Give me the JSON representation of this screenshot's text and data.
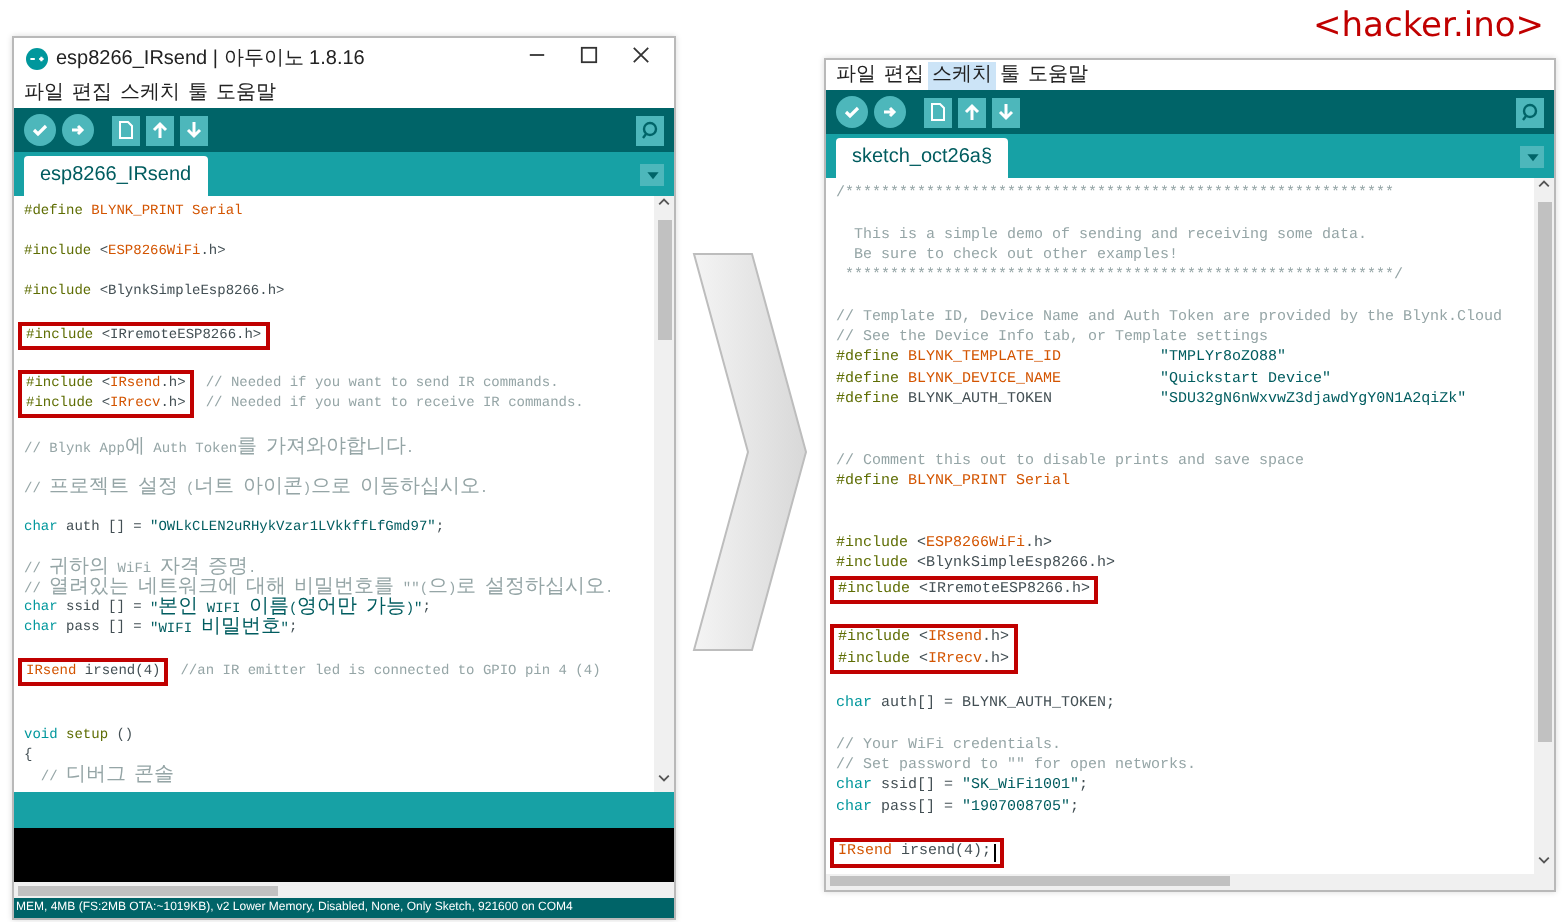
{
  "caption": "<hacker.ino>",
  "windows": [
    {
      "title": "esp8266_IRsend | 아두이노 1.8.16",
      "menu": [
        {
          "label": "파일",
          "selected": false
        },
        {
          "label": "편집",
          "selected": false
        },
        {
          "label": "스케치",
          "selected": false
        },
        {
          "label": "툴",
          "selected": false
        },
        {
          "label": "도움말",
          "selected": false
        }
      ],
      "tab": "esp8266_IRsend",
      "code": [
        {
          "highlighted": false,
          "lines": [
            {
              "kind": "code",
              "tokens": [
                {
                  "kind": "directive",
                  "text": "#define "
                },
                {
                  "kind": "macro",
                  "text": "BLYNK_PRINT Serial"
                }
              ]
            },
            {
              "kind": "blank"
            },
            {
              "kind": "code",
              "tokens": [
                {
                  "kind": "directive",
                  "text": "#include "
                },
                {
                  "kind": "plain",
                  "text": "<"
                },
                {
                  "kind": "macro",
                  "text": "ESP8266WiFi"
                },
                {
                  "kind": "plain",
                  "text": ".h>"
                }
              ]
            },
            {
              "kind": "blank"
            },
            {
              "kind": "code",
              "tokens": [
                {
                  "kind": "directive",
                  "text": "#include "
                },
                {
                  "kind": "plain",
                  "text": "<BlynkSimpleEsp8266.h>"
                }
              ]
            },
            {
              "kind": "blank"
            }
          ]
        },
        {
          "highlighted": true,
          "lines": [
            {
              "kind": "code",
              "tokens": [
                {
                  "kind": "directive",
                  "text": "#include "
                },
                {
                  "kind": "plain",
                  "text": "<IRremoteESP8266.h>"
                }
              ]
            }
          ]
        },
        {
          "highlighted": false,
          "lines": [
            {
              "kind": "blank"
            }
          ]
        },
        {
          "highlighted": true,
          "lines": [
            {
              "kind": "code",
              "tokens": [
                {
                  "kind": "directive",
                  "text": "#include "
                },
                {
                  "kind": "plain",
                  "text": "<"
                },
                {
                  "kind": "macro",
                  "text": "IRsend"
                },
                {
                  "kind": "plain",
                  "text": ".h>"
                }
              ],
              "trailing": [
                {
                  "kind": "comment",
                  "text": "// Needed if you want to send IR commands."
                }
              ]
            },
            {
              "kind": "code",
              "tokens": [
                {
                  "kind": "directive",
                  "text": "#include "
                },
                {
                  "kind": "plain",
                  "text": "<"
                },
                {
                  "kind": "macro",
                  "text": "IRrecv"
                },
                {
                  "kind": "plain",
                  "text": ".h>"
                }
              ],
              "trailing": [
                {
                  "kind": "comment",
                  "text": "// Needed if you want to receive IR commands."
                }
              ]
            }
          ]
        },
        {
          "highlighted": false,
          "lines": [
            {
              "kind": "blank"
            },
            {
              "kind": "code",
              "tokens": [
                {
                  "kind": "comment",
                  "text": "// Blynk App에 Auth Token를 가져와야합니다."
                }
              ]
            },
            {
              "kind": "blank"
            },
            {
              "kind": "code",
              "tokens": [
                {
                  "kind": "comment",
                  "text": "// 프로젝트 설정 (너트 아이콘)으로 이동하십시오."
                }
              ]
            },
            {
              "kind": "blank"
            },
            {
              "kind": "code",
              "tokens": [
                {
                  "kind": "type",
                  "text": "char"
                },
                {
                  "kind": "plain",
                  "text": " auth [] = "
                },
                {
                  "kind": "string",
                  "text": "\"OWLkCLEN2uRHykVzar1LVkkffLfGmd97\""
                },
                {
                  "kind": "plain",
                  "text": ";"
                }
              ]
            },
            {
              "kind": "blank"
            },
            {
              "kind": "code",
              "tokens": [
                {
                  "kind": "comment",
                  "text": "// 귀하의 WiFi 자격 증명."
                }
              ]
            },
            {
              "kind": "code",
              "tokens": [
                {
                  "kind": "comment",
                  "text": "// 열려있는 네트워크에 대해 비밀번호를 \"\"(으)로 설정하십시오."
                }
              ]
            },
            {
              "kind": "code",
              "tokens": [
                {
                  "kind": "type",
                  "text": "char"
                },
                {
                  "kind": "plain",
                  "text": " ssid [] = "
                },
                {
                  "kind": "string",
                  "text": "\"본인 WIFI 이름(영어만 가능)\""
                },
                {
                  "kind": "plain",
                  "text": ";"
                }
              ]
            },
            {
              "kind": "code",
              "tokens": [
                {
                  "kind": "type",
                  "text": "char"
                },
                {
                  "kind": "plain",
                  "text": " pass [] = "
                },
                {
                  "kind": "string",
                  "text": "\"WIFI 비밀번호\""
                },
                {
                  "kind": "plain",
                  "text": ";"
                }
              ]
            },
            {
              "kind": "blank"
            }
          ]
        },
        {
          "highlighted": true,
          "lines": [
            {
              "kind": "code",
              "tokens": [
                {
                  "kind": "macro",
                  "text": "IRsend"
                },
                {
                  "kind": "plain",
                  "text": " irsend(4)"
                }
              ],
              "trailing": [
                {
                  "kind": "comment",
                  "text": "//an IR emitter led is connected to GPIO pin 4 (4)"
                }
              ]
            }
          ]
        },
        {
          "highlighted": false,
          "lines": [
            {
              "kind": "blank"
            },
            {
              "kind": "blank"
            },
            {
              "kind": "code",
              "tokens": [
                {
                  "kind": "type",
                  "text": "void "
                },
                {
                  "kind": "directive",
                  "text": "setup"
                },
                {
                  "kind": "plain",
                  "text": " ()"
                }
              ]
            },
            {
              "kind": "code",
              "tokens": [
                {
                  "kind": "plain",
                  "text": "{"
                }
              ]
            },
            {
              "kind": "code",
              "tokens": [
                {
                  "kind": "comment",
                  "text": "  // 디버그 콘솔"
                }
              ]
            }
          ]
        }
      ],
      "status": "MEM, 4MB (FS:2MB OTA:~1019KB), v2 Lower Memory, Disabled, None, Only Sketch, 921600 on COM4"
    },
    {
      "menu": [
        {
          "label": "파일",
          "selected": false
        },
        {
          "label": "편집",
          "selected": false
        },
        {
          "label": "스케치",
          "selected": true
        },
        {
          "label": "툴",
          "selected": false
        },
        {
          "label": "도움말",
          "selected": false
        }
      ],
      "tab": "sketch_oct26a§",
      "code": [
        {
          "highlighted": false,
          "lines": [
            {
              "kind": "code",
              "tokens": [
                {
                  "kind": "comment",
                  "text": "/*************************************************************"
                }
              ]
            },
            {
              "kind": "blank"
            },
            {
              "kind": "code",
              "tokens": [
                {
                  "kind": "comment",
                  "text": "  This is a simple demo of sending and receiving some data."
                }
              ]
            },
            {
              "kind": "code",
              "tokens": [
                {
                  "kind": "comment",
                  "text": "  Be sure to check out other examples!"
                }
              ]
            },
            {
              "kind": "code",
              "tokens": [
                {
                  "kind": "comment",
                  "text": " *************************************************************/"
                }
              ]
            },
            {
              "kind": "blank"
            },
            {
              "kind": "code",
              "tokens": [
                {
                  "kind": "comment",
                  "text": "// Template ID, Device Name and Auth Token are provided by the Blynk.Cloud"
                }
              ]
            },
            {
              "kind": "code",
              "tokens": [
                {
                  "kind": "comment",
                  "text": "// See the Device Info tab, or Template settings"
                }
              ]
            },
            {
              "kind": "code",
              "tokens": [
                {
                  "kind": "directive",
                  "text": "#define "
                },
                {
                  "kind": "macro",
                  "text": "BLYNK_TEMPLATE_ID           "
                },
                {
                  "kind": "string",
                  "text": "\"TMPLYr8oZO88\""
                }
              ]
            },
            {
              "kind": "code",
              "tokens": [
                {
                  "kind": "directive",
                  "text": "#define "
                },
                {
                  "kind": "macro",
                  "text": "BLYNK_DEVICE_NAME           "
                },
                {
                  "kind": "string",
                  "text": "\"Quickstart Device\""
                }
              ]
            },
            {
              "kind": "code",
              "tokens": [
                {
                  "kind": "directive",
                  "text": "#define "
                },
                {
                  "kind": "plain",
                  "text": "BLYNK_AUTH_TOKEN            "
                },
                {
                  "kind": "string",
                  "text": "\"SDU32gN6nWxvwZ3djawdYgY0N1A2qiZk\""
                }
              ]
            },
            {
              "kind": "blank"
            },
            {
              "kind": "blank"
            },
            {
              "kind": "code",
              "tokens": [
                {
                  "kind": "comment",
                  "text": "// Comment this out to disable prints and save space"
                }
              ]
            },
            {
              "kind": "code",
              "tokens": [
                {
                  "kind": "directive",
                  "text": "#define "
                },
                {
                  "kind": "macro",
                  "text": "BLYNK_PRINT Serial"
                }
              ]
            },
            {
              "kind": "blank"
            },
            {
              "kind": "blank"
            },
            {
              "kind": "code",
              "tokens": [
                {
                  "kind": "directive",
                  "text": "#include "
                },
                {
                  "kind": "plain",
                  "text": "<"
                },
                {
                  "kind": "macro",
                  "text": "ESP8266WiFi"
                },
                {
                  "kind": "plain",
                  "text": ".h>"
                }
              ]
            },
            {
              "kind": "code",
              "tokens": [
                {
                  "kind": "directive",
                  "text": "#include "
                },
                {
                  "kind": "plain",
                  "text": "<BlynkSimpleEsp8266.h>"
                }
              ]
            }
          ]
        },
        {
          "highlighted": true,
          "lines": [
            {
              "kind": "code",
              "tokens": [
                {
                  "kind": "directive",
                  "text": "#include "
                },
                {
                  "kind": "plain",
                  "text": "<IRremoteESP8266.h>"
                }
              ]
            }
          ]
        },
        {
          "highlighted": false,
          "lines": [
            {
              "kind": "blank"
            }
          ]
        },
        {
          "highlighted": true,
          "lines": [
            {
              "kind": "code",
              "tokens": [
                {
                  "kind": "directive",
                  "text": "#include "
                },
                {
                  "kind": "plain",
                  "text": "<"
                },
                {
                  "kind": "macro",
                  "text": "IRsend"
                },
                {
                  "kind": "plain",
                  "text": ".h>"
                }
              ]
            },
            {
              "kind": "code",
              "tokens": [
                {
                  "kind": "directive",
                  "text": "#include "
                },
                {
                  "kind": "plain",
                  "text": "<"
                },
                {
                  "kind": "macro",
                  "text": "IRrecv"
                },
                {
                  "kind": "plain",
                  "text": ".h>"
                }
              ]
            }
          ]
        },
        {
          "highlighted": false,
          "lines": [
            {
              "kind": "blank"
            },
            {
              "kind": "code",
              "tokens": [
                {
                  "kind": "type",
                  "text": "char"
                },
                {
                  "kind": "plain",
                  "text": " auth[] = BLYNK_AUTH_TOKEN;"
                }
              ]
            },
            {
              "kind": "blank"
            },
            {
              "kind": "code",
              "tokens": [
                {
                  "kind": "comment",
                  "text": "// Your WiFi credentials."
                }
              ]
            },
            {
              "kind": "code",
              "tokens": [
                {
                  "kind": "comment",
                  "text": "// Set password to \"\" for open networks."
                }
              ]
            },
            {
              "kind": "code",
              "tokens": [
                {
                  "kind": "type",
                  "text": "char"
                },
                {
                  "kind": "plain",
                  "text": " ssid[] = "
                },
                {
                  "kind": "string",
                  "text": "\"SK_WiFi1001\""
                },
                {
                  "kind": "plain",
                  "text": ";"
                }
              ]
            },
            {
              "kind": "code",
              "tokens": [
                {
                  "kind": "type",
                  "text": "char"
                },
                {
                  "kind": "plain",
                  "text": " pass[] = "
                },
                {
                  "kind": "string",
                  "text": "\"1907008705\""
                },
                {
                  "kind": "plain",
                  "text": ";"
                }
              ]
            },
            {
              "kind": "blank"
            }
          ]
        },
        {
          "highlighted": true,
          "lines": [
            {
              "kind": "code",
              "tokens": [
                {
                  "kind": "macro",
                  "text": "IRsend"
                },
                {
                  "kind": "plain",
                  "text": " irsend(4);"
                }
              ],
              "cursor": true
            }
          ]
        }
      ]
    }
  ]
}
